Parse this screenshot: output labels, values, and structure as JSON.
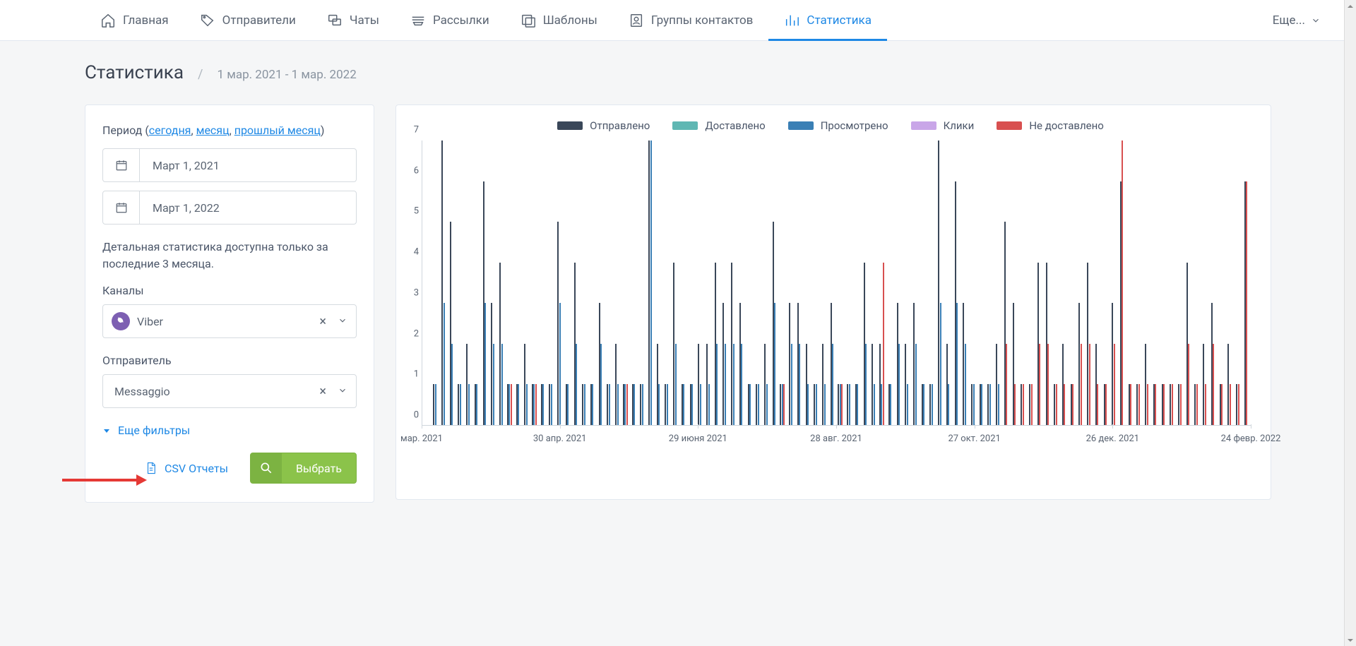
{
  "nav": {
    "items": [
      {
        "label": "Главная",
        "name": "nav-home"
      },
      {
        "label": "Отправители",
        "name": "nav-senders"
      },
      {
        "label": "Чаты",
        "name": "nav-chats"
      },
      {
        "label": "Рассылки",
        "name": "nav-campaigns"
      },
      {
        "label": "Шаблоны",
        "name": "nav-templates"
      },
      {
        "label": "Группы контактов",
        "name": "nav-contact-groups"
      },
      {
        "label": "Статистика",
        "name": "nav-statistics",
        "active": true
      }
    ],
    "more_label": "Еще..."
  },
  "page": {
    "title": "Статистика",
    "date_range": "1 мар. 2021 - 1 мар. 2022"
  },
  "filters": {
    "period_label": "Период",
    "period_links": {
      "today": "сегодня",
      "month": "месяц",
      "last_month": "прошлый месяц"
    },
    "date_from": "Март 1, 2021",
    "date_to": "Март 1, 2022",
    "info_text": "Детальная статистика доступна только за последние 3 месяца.",
    "channels_label": "Каналы",
    "channel_value": "Viber",
    "sender_label": "Отправитель",
    "sender_value": "Messaggio",
    "more_filters": "Еще фильтры",
    "csv_reports": "CSV Отчеты",
    "select_btn": "Выбрать"
  },
  "chart_data": {
    "type": "bar",
    "title": "",
    "ylim": [
      0,
      7
    ],
    "yticks": [
      0,
      1,
      2,
      3,
      4,
      5,
      6,
      7
    ],
    "x_labels": [
      "мар. 2021",
      "30 апр. 2021",
      "29 июня 2021",
      "28 авг. 2021",
      "27 окт. 2021",
      "26 дек. 2021",
      "24 февр. 2022"
    ],
    "legend": [
      {
        "name": "Отправлено",
        "color": "#3a4759"
      },
      {
        "name": "Доставлено",
        "color": "#5fb7b3"
      },
      {
        "name": "Просмотрено",
        "color": "#3a7fb5"
      },
      {
        "name": "Клики",
        "color": "#c9a6e8"
      },
      {
        "name": "Не доставлено",
        "color": "#d85050"
      }
    ],
    "series": [
      {
        "name": "Отправлено",
        "color": "#3a4759",
        "values": [
          0,
          1,
          7,
          5,
          1,
          2,
          1,
          6,
          3,
          4,
          1,
          1,
          2,
          1,
          1,
          1,
          5,
          1,
          4,
          1,
          1,
          3,
          1,
          2,
          1,
          1,
          1,
          7,
          2,
          1,
          4,
          1,
          1,
          2,
          2,
          4,
          3,
          4,
          3,
          1,
          1,
          2,
          5,
          1,
          3,
          3,
          2,
          1,
          2,
          3,
          1,
          1,
          1,
          4,
          2,
          2,
          1,
          3,
          2,
          3,
          1,
          1,
          7,
          2,
          6,
          3,
          1,
          1,
          1,
          2,
          5,
          3,
          1,
          1,
          4,
          4,
          1,
          2,
          1,
          3,
          4,
          2,
          1,
          3,
          6,
          1,
          1,
          2,
          1,
          1,
          1,
          1,
          4,
          1,
          2,
          3,
          1,
          2,
          1,
          6
        ]
      },
      {
        "name": "Просмотрено",
        "color": "#3a7fb5",
        "values": [
          0,
          1,
          3,
          2,
          1,
          1,
          1,
          3,
          2,
          2,
          1,
          1,
          1,
          1,
          1,
          1,
          3,
          1,
          2,
          1,
          1,
          2,
          1,
          1,
          1,
          1,
          1,
          7,
          1,
          1,
          2,
          1,
          1,
          1,
          1,
          2,
          2,
          2,
          2,
          1,
          1,
          1,
          3,
          1,
          2,
          2,
          1,
          1,
          1,
          2,
          1,
          1,
          1,
          2,
          1,
          1,
          1,
          2,
          1,
          2,
          1,
          1,
          3,
          1,
          3,
          2,
          1,
          1,
          1,
          1,
          0,
          0,
          0,
          0,
          0,
          0,
          0,
          0,
          0,
          0,
          0,
          0,
          0,
          0,
          0,
          0,
          0,
          0,
          0,
          0,
          0,
          0,
          0,
          0,
          0,
          0,
          0,
          0,
          0,
          0
        ]
      },
      {
        "name": "Не доставлено",
        "color": "#d85050",
        "values": [
          0,
          0,
          0,
          0,
          0,
          0,
          0,
          0,
          0,
          0,
          1,
          0,
          0,
          1,
          0,
          0,
          0,
          0,
          0,
          0,
          0,
          0,
          0,
          0,
          1,
          0,
          0,
          0,
          0,
          0,
          0,
          0,
          0,
          0,
          0,
          0,
          0,
          0,
          0,
          0,
          0,
          0,
          0,
          1,
          0,
          0,
          0,
          0,
          0,
          0,
          1,
          0,
          0,
          0,
          0,
          4,
          0,
          0,
          0,
          0,
          0,
          0,
          0,
          0,
          0,
          0,
          0,
          0,
          0,
          0,
          2,
          1,
          1,
          1,
          2,
          2,
          1,
          1,
          1,
          2,
          2,
          1,
          1,
          2,
          7,
          1,
          1,
          1,
          1,
          1,
          1,
          1,
          2,
          1,
          1,
          2,
          1,
          1,
          1,
          6
        ]
      }
    ]
  },
  "colors": {
    "accent": "#1e88e5",
    "success": "#8bc34a"
  }
}
